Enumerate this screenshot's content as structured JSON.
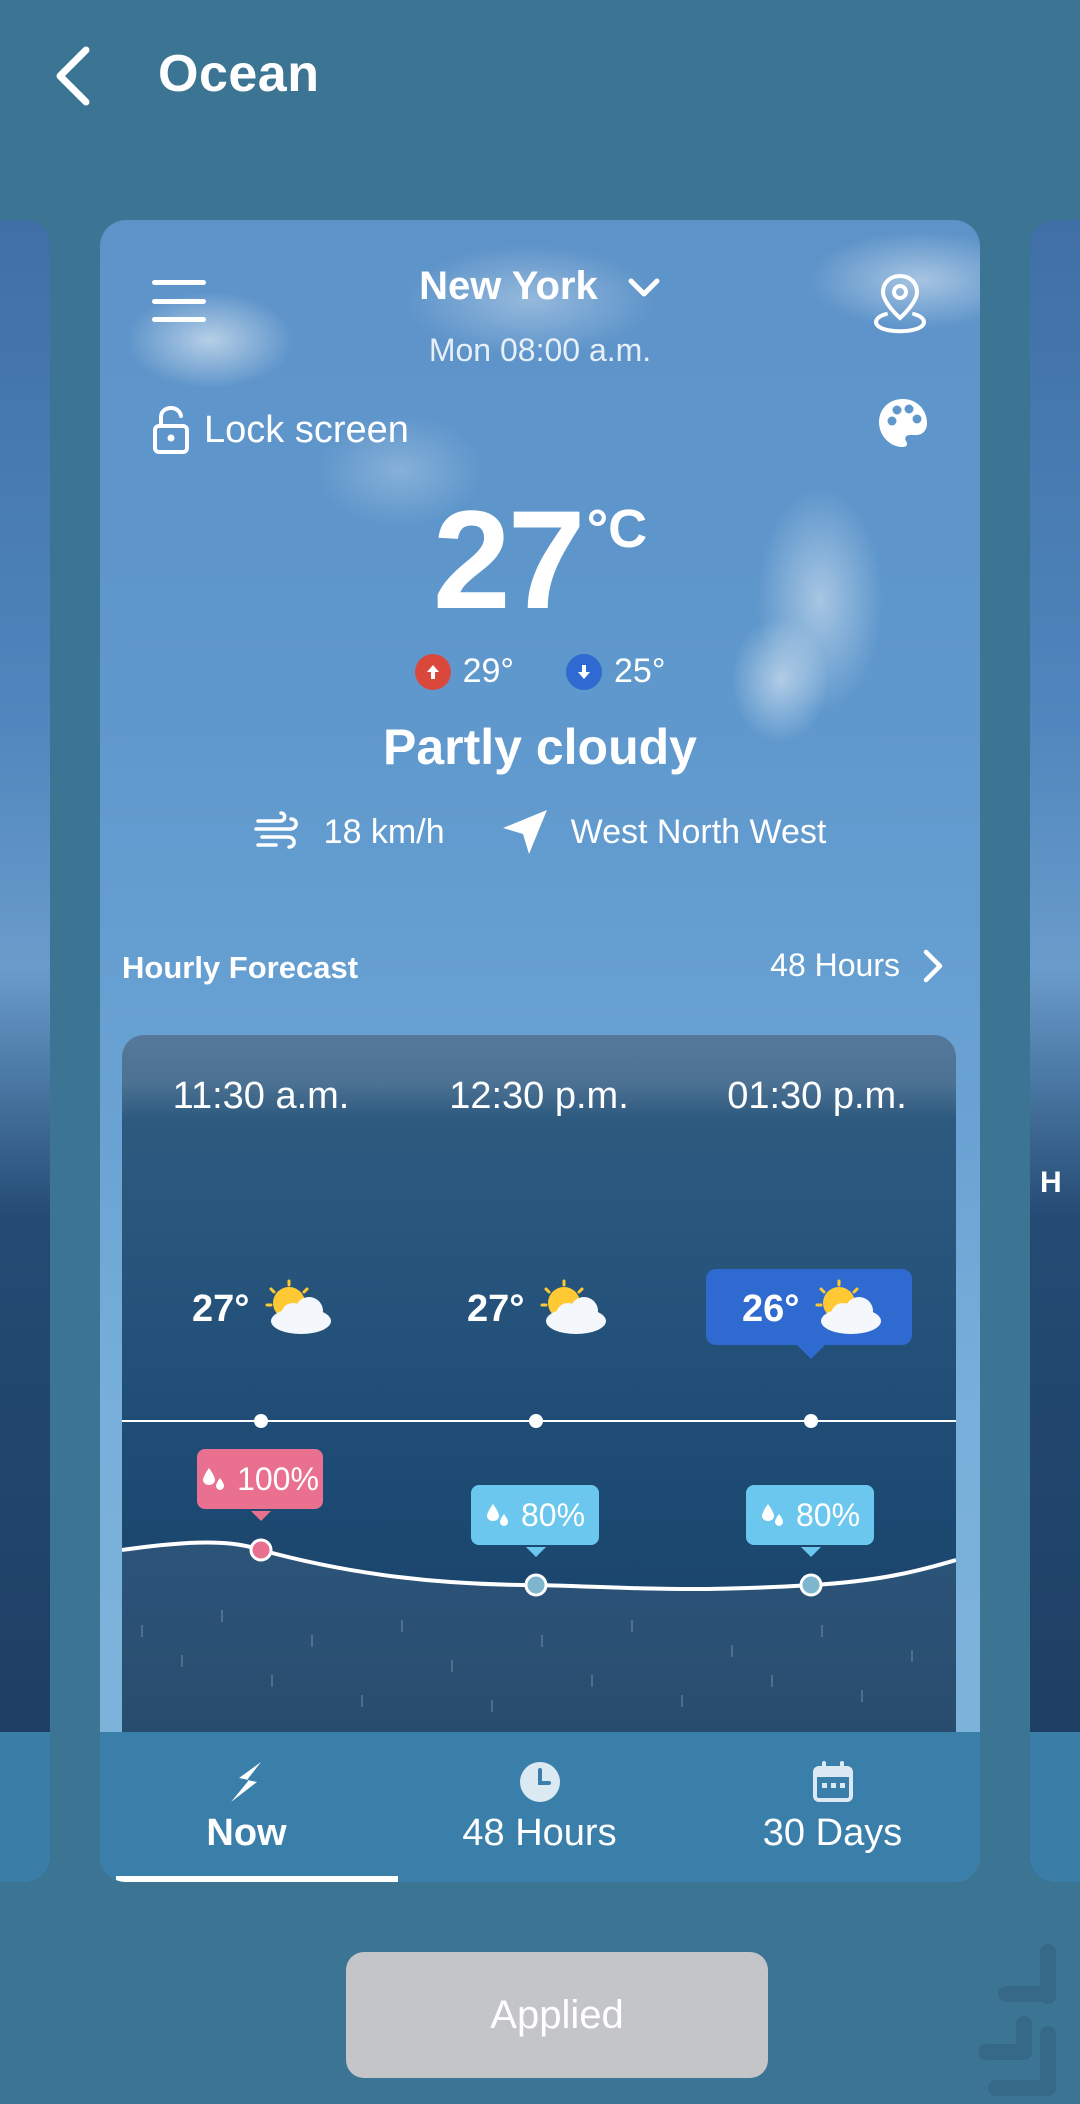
{
  "header": {
    "title": "Ocean",
    "back_icon": "chevron-left-icon"
  },
  "card": {
    "menu_icon": "hamburger-menu-icon",
    "city": "New York",
    "datetime": "Mon 08:00 a.m.",
    "lock_label": "Lock screen",
    "temperature": "27",
    "temperature_unit": "°C",
    "high": "29°",
    "low": "25°",
    "condition": "Partly cloudy",
    "wind_speed": "18 km/h",
    "wind_direction": "West North West",
    "hourly_title": "Hourly Forecast",
    "hourly_more": "48 Hours",
    "colors": {
      "high": "#d9483b",
      "low": "#2f6ad0",
      "highlight": "#2f6ad0",
      "rain_high": "#e9708f",
      "rain": "#6cc7ef"
    }
  },
  "hourly": [
    {
      "time": "11:30 a.m.",
      "temp": "27°",
      "rain": "100%",
      "icon": "partly-cloudy-icon"
    },
    {
      "time": "12:30 p.m.",
      "temp": "27°",
      "rain": "80%",
      "icon": "partly-cloudy-icon"
    },
    {
      "time": "01:30 p.m.",
      "temp": "26°",
      "rain": "80%",
      "icon": "partly-cloudy-icon"
    }
  ],
  "nav": [
    {
      "label": "Now",
      "icon": "lightning-icon",
      "active": true
    },
    {
      "label": "48 Hours",
      "icon": "clock-icon",
      "active": false
    },
    {
      "label": "30 Days",
      "icon": "calendar-icon",
      "active": false
    }
  ],
  "side_preview": {
    "right_label": "H"
  },
  "apply_button": "Applied"
}
